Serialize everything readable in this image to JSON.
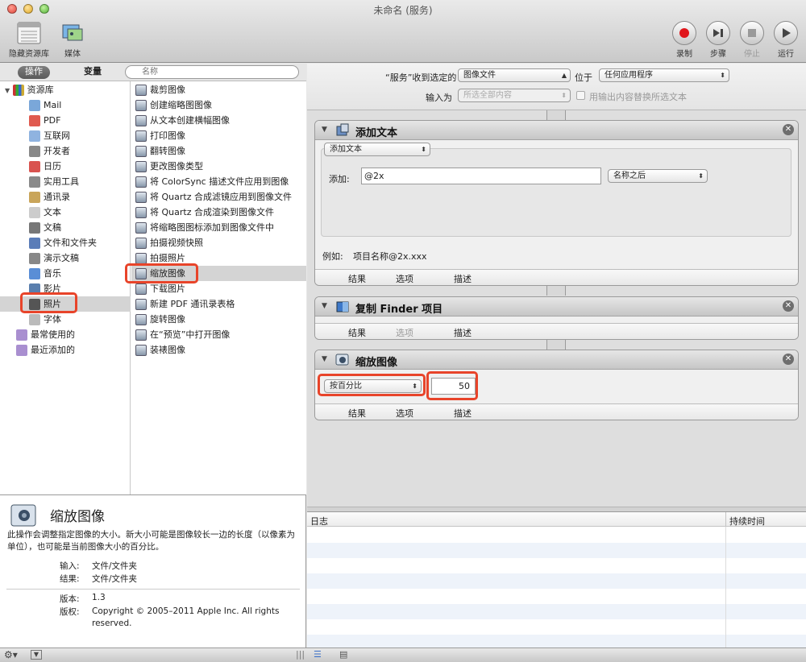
{
  "window": {
    "title": "未命名 (服务)"
  },
  "toolbar": {
    "left_buttons": [
      {
        "label": "隐藏资源库",
        "icon": "library-icon"
      },
      {
        "label": "媒体",
        "icon": "media-icon"
      }
    ],
    "right_buttons": [
      {
        "label": "录制",
        "icon": "record-icon"
      },
      {
        "label": "步骤",
        "icon": "step-icon"
      },
      {
        "label": "停止",
        "icon": "stop-icon"
      },
      {
        "label": "运行",
        "icon": "run-icon"
      }
    ]
  },
  "segment": {
    "actions": "操作",
    "variables": "变量"
  },
  "search": {
    "placeholder": "名称"
  },
  "library": {
    "root": "资源库",
    "items": [
      "Mail",
      "PDF",
      "互联网",
      "开发者",
      "日历",
      "实用工具",
      "通讯录",
      "文本",
      "文稿",
      "文件和文件夹",
      "演示文稿",
      "音乐",
      "影片",
      "照片",
      "字体"
    ],
    "selected": "照片",
    "extra": [
      "最常使用的",
      "最近添加的"
    ]
  },
  "actions_list": {
    "items": [
      "裁剪图像",
      "创建缩略图图像",
      "从文本创建横幅图像",
      "打印图像",
      "翻转图像",
      "更改图像类型",
      "将 ColorSync 描述文件应用到图像",
      "将 Quartz 合成滤镜应用到图像文件",
      "将 Quartz 合成渲染到图像文件",
      "将缩略图图标添加到图像文件中",
      "拍摄视频快照",
      "拍摄照片",
      "缩放图像",
      "下载图片",
      "新建 PDF 通讯录表格",
      "旋转图像",
      "在“预览”中打开图像",
      "装裱图像"
    ],
    "selected": "缩放图像"
  },
  "description": {
    "title": "缩放图像",
    "text": "此操作会调整指定图像的大小。新大小可能是图像较长一边的长度（以像素为单位），也可能是当前图像大小的百分比。",
    "input_label": "输入:",
    "input_value": "文件/文件夹",
    "result_label": "结果:",
    "result_value": "文件/文件夹",
    "version_label": "版本:",
    "version_value": "1.3",
    "copyright_label": "版权:",
    "copyright_value": "Copyright © 2005–2011 Apple Inc.  All rights reserved."
  },
  "service_header": {
    "receives_label": "“服务”收到选定的",
    "receives_value": "图像文件",
    "in_label": "位于",
    "in_value": "任何应用程序",
    "input_is_label": "输入为",
    "input_is_value": "所选全部内容",
    "replace_label": "用输出内容替换所选文本"
  },
  "workflow": {
    "action1": {
      "title": "添加文本",
      "mode": "添加文本",
      "add_label": "添加:",
      "add_value": "@2x",
      "position": "名称之后",
      "example_label": "例如:",
      "example_value": "项目名称@2x.xxx",
      "tabs": [
        "结果",
        "选项",
        "描述"
      ]
    },
    "action2": {
      "title": "复制 Finder 项目",
      "tabs": [
        "结果",
        "选项",
        "描述"
      ]
    },
    "action3": {
      "title": "缩放图像",
      "mode": "按百分比",
      "value": "50",
      "tabs": [
        "结果",
        "选项",
        "描述"
      ]
    }
  },
  "log": {
    "col_log": "日志",
    "col_duration": "持续时间"
  },
  "colors": {
    "highlight": "#e8442a",
    "record": "#e0161b"
  }
}
